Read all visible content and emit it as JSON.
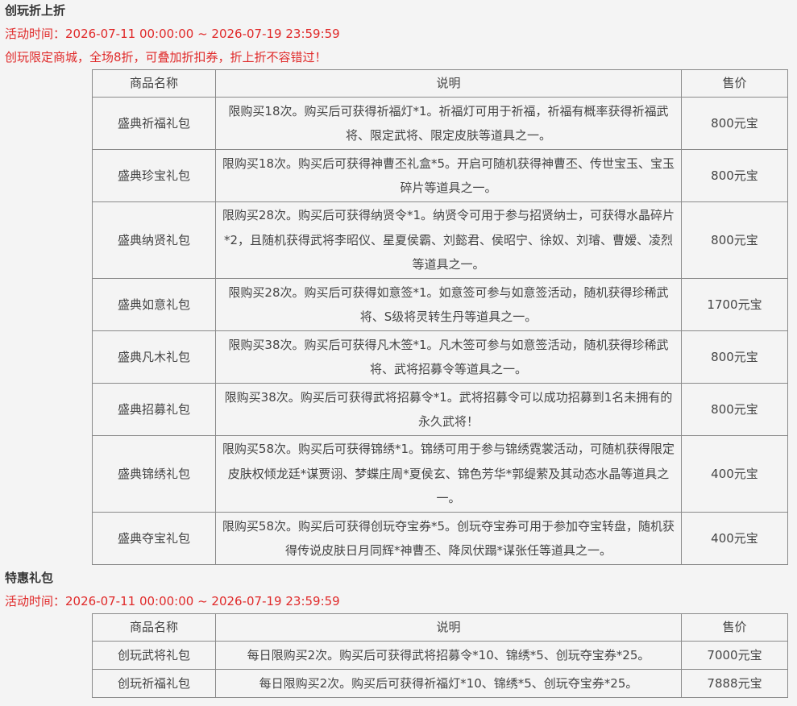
{
  "sections": [
    {
      "title": "创玩折上折",
      "time": "活动时间：2026-07-11 00:00:00 ~ 2026-07-19 23:59:59",
      "note": "创玩限定商城，全场8折，可叠加折扣券，折上折不容错过！",
      "headers": [
        "商品名称",
        "说明",
        "售价"
      ],
      "rows": [
        {
          "name": "盛典祈福礼包",
          "desc": "限购买18次。购买后可获得祈福灯*1。祈福灯可用于祈福，祈福有概率获得祈福武将、限定武将、限定皮肤等道具之一。",
          "price": "800元宝"
        },
        {
          "name": "盛典珍宝礼包",
          "desc": "限购买18次。购买后可获得神曹丕礼盒*5。开启可随机获得神曹丕、传世宝玉、宝玉碎片等道具之一。",
          "price": "800元宝"
        },
        {
          "name": "盛典纳贤礼包",
          "desc": "限购买28次。购买后可获得纳贤令*1。纳贤令可用于参与招贤纳士，可获得水晶碎片*2，且随机获得武将李昭仪、星夏侯霸、刘懿君、侯昭宁、徐奴、刘璿、曹嫒、凌烈等道具之一。",
          "price": "800元宝"
        },
        {
          "name": "盛典如意礼包",
          "desc": "限购买28次。购买后可获得如意签*1。如意签可参与如意签活动，随机获得珍稀武将、S级将灵转生丹等道具之一。",
          "price": "1700元宝"
        },
        {
          "name": "盛典凡木礼包",
          "desc": "限购买38次。购买后可获得凡木签*1。凡木签可参与如意签活动，随机获得珍稀武将、武将招募令等道具之一。",
          "price": "800元宝"
        },
        {
          "name": "盛典招募礼包",
          "desc": "限购买38次。购买后可获得武将招募令*1。武将招募令可以成功招募到1名未拥有的永久武将！",
          "price": "800元宝"
        },
        {
          "name": "盛典锦绣礼包",
          "desc": "限购买58次。购买后可获得锦绣*1。锦绣可用于参与锦绣霓裳活动，可随机获得限定皮肤权倾龙廷*谋贾诩、梦蝶庄周*夏侯玄、锦色芳华*郭缇萦及其动态水晶等道具之一。",
          "price": "400元宝"
        },
        {
          "name": "盛典夺宝礼包",
          "desc": "限购买58次。购买后可获得创玩夺宝券*5。创玩夺宝券可用于参加夺宝转盘，随机获得传说皮肤日月同辉*神曹丕、降凤伏蹋*谋张任等道具之一。",
          "price": "400元宝"
        }
      ]
    },
    {
      "title": "特惠礼包",
      "time": "活动时间：2026-07-11 00:00:00 ~ 2026-07-19 23:59:59",
      "headers": [
        "商品名称",
        "说明",
        "售价"
      ],
      "rows": [
        {
          "name": "创玩武将礼包",
          "desc": "每日限购买2次。购买后可获得武将招募令*10、锦绣*5、创玩夺宝券*25。",
          "price": "7000元宝"
        },
        {
          "name": "创玩祈福礼包",
          "desc": "每日限购买2次。购买后可获得祈福灯*10、锦绣*5、创玩夺宝券*25。",
          "price": "7888元宝"
        }
      ]
    }
  ]
}
